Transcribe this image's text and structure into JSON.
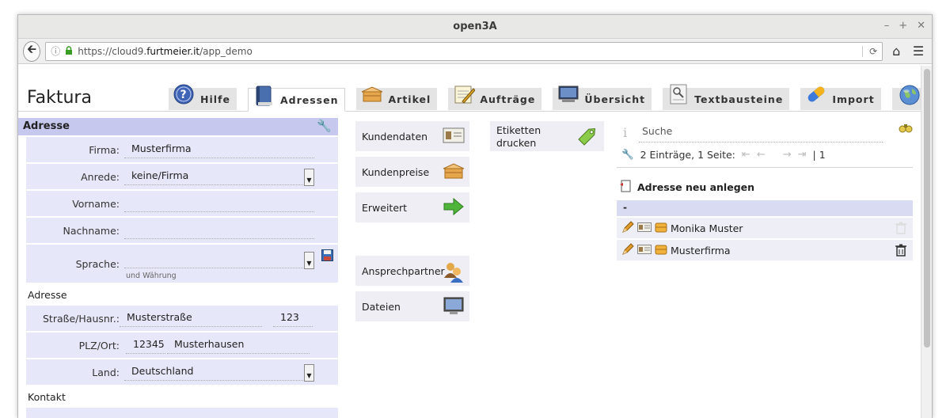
{
  "window": {
    "title": "open3A",
    "controls": [
      "–",
      "+",
      "✕"
    ]
  },
  "browser": {
    "url_prefix": "https://cloud9.",
    "url_domain": "furtmeier.it",
    "url_path": "/app_demo"
  },
  "app": {
    "brand": "Faktura"
  },
  "tabs": [
    {
      "label": "Hilfe",
      "icon": "help-icon"
    },
    {
      "label": "Adressen",
      "icon": "address-book-icon",
      "active": true
    },
    {
      "label": "Artikel",
      "icon": "box-icon"
    },
    {
      "label": "Aufträge",
      "icon": "notepad-icon"
    },
    {
      "label": "Übersicht",
      "icon": "monitor-icon"
    },
    {
      "label": "Textbausteine",
      "icon": "text-document-icon"
    },
    {
      "label": "Import",
      "icon": "pill-icon"
    },
    {
      "label": "",
      "icon": "globe-icon"
    }
  ],
  "form": {
    "header": "Adresse",
    "firma_label": "Firma:",
    "firma_value": "Musterfirma",
    "anrede_label": "Anrede:",
    "anrede_value": "keine/Firma",
    "vorname_label": "Vorname:",
    "nachname_label": "Nachname:",
    "sprache_label": "Sprache:",
    "sprache_hint": "und Währung",
    "section_adresse": "Adresse",
    "strasse_label": "Straße/Hausnr.:",
    "strasse_value": "Musterstraße",
    "hausnr_value": "123",
    "plz_label": "PLZ/Ort:",
    "plz_value": "12345",
    "ort_value": "Musterhausen",
    "land_label": "Land:",
    "land_value": "Deutschland",
    "section_kontakt": "Kontakt"
  },
  "middle": {
    "kundendaten": "Kundendaten",
    "kundenpreise": "Kundenpreise",
    "erweitert": "Erweitert",
    "ansprechpartner": "Ansprechpartner",
    "dateien": "Dateien",
    "etiketten_line1": "Etiketten",
    "etiketten_line2": "drucken"
  },
  "right": {
    "search_placeholder": "Suche",
    "paging_text": "2 Einträge, 1 Seite:",
    "paging_page": "| 1",
    "new_address": "Adresse neu anlegen",
    "list_header": "-",
    "rows": [
      {
        "name": "Monika Muster"
      },
      {
        "name": "Musterfirma"
      }
    ]
  },
  "colors": {
    "header_band": "#c6c8ee",
    "row_band": "#e6e7f8",
    "tab_bg": "#e4e4e4"
  }
}
